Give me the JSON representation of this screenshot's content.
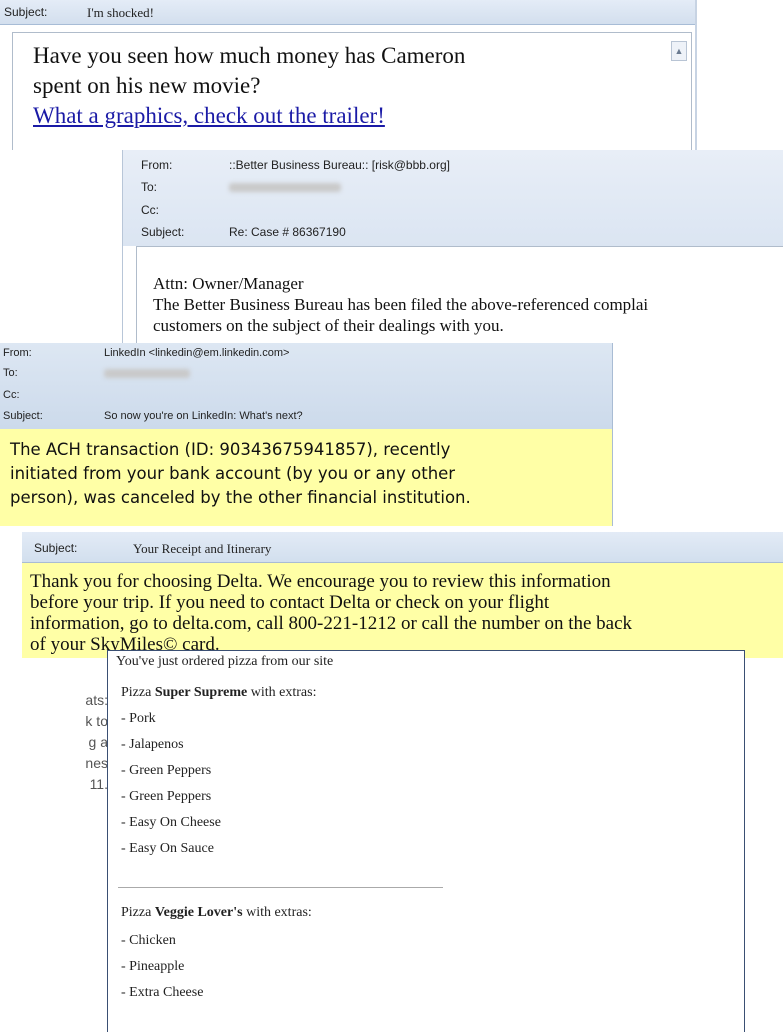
{
  "email1": {
    "subject_label": "Subject:",
    "subject": "I'm shocked!",
    "body_line1": "Have you seen how much money has Cameron",
    "body_line2": "spent on his new movie?",
    "link": "What a graphics, check out the trailer!",
    "scroll_icon": "▲"
  },
  "email2": {
    "from_label": "From:",
    "from": "::Better Business Bureau:: [risk@bbb.org]",
    "to_label": "To:",
    "cc_label": "Cc:",
    "subject_label": "Subject:",
    "subject": "Re: Case # 86367190",
    "body_line1": "Attn: Owner/Manager",
    "body_line2": "The Better Business Bureau has been filed the above-referenced complai",
    "body_line3": "customers on the subject of their dealings with you."
  },
  "email3": {
    "from_label": "From:",
    "from": "LinkedIn <linkedin@em.linkedin.com>",
    "to_label": "To:",
    "cc_label": "Cc:",
    "subject_label": "Subject:",
    "subject": "So now you're on LinkedIn: What's next?",
    "body_line1": "The ACH transaction (ID: 90343675941857), recently",
    "body_line2": "initiated from your bank account (by you or any other",
    "body_line3": "person), was canceled by the other financial institution."
  },
  "email4": {
    "subject_label": "Subject:",
    "subject": "Your Receipt and Itinerary",
    "body_line1": "Thank you for choosing Delta. We encourage you to review this information",
    "body_line2": "before your trip. If you need to contact Delta or check on your flight",
    "body_line3": "information, go to delta.com, call 800-221-1212 or call the number on the back",
    "body_line4": "of your SkyMiles© card."
  },
  "email5": {
    "intro": "You've just ordered pizza from our site",
    "pizza1_prefix": "Pizza ",
    "pizza1_name": "Super Supreme",
    "pizza1_suffix": " with extras:",
    "pizza1_extras": [
      "- Pork",
      "- Jalapenos",
      "- Green Peppers",
      "- Green Peppers",
      "- Easy On Cheese",
      "- Easy On Sauce"
    ],
    "pizza2_prefix": "Pizza ",
    "pizza2_name": "Veggie Lover's",
    "pizza2_suffix": " with extras:",
    "pizza2_extras": [
      "- Chicken",
      "- Pineapple",
      "- Extra Cheese"
    ]
  },
  "side_text": {
    "lines": [
      "ats:",
      "k to",
      "g a",
      "nes",
      "11."
    ]
  },
  "colors": {
    "header_blue": "#d8e3f1",
    "yellow_body": "#ffffa6",
    "link_blue": "#1a1aa6"
  }
}
